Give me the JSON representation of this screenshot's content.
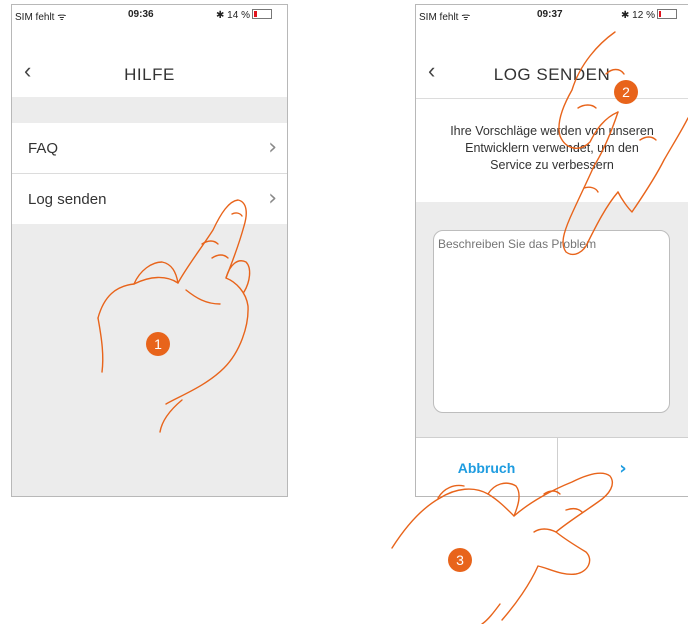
{
  "screen1": {
    "status": {
      "carrier": "SIM fehlt",
      "time": "09:36",
      "battery": "14 %"
    },
    "nav": {
      "back_icon": "‹",
      "title": "HILFE"
    },
    "menu": [
      {
        "label": "FAQ",
        "chevron": "›"
      },
      {
        "label": "Log senden",
        "chevron": "›"
      }
    ]
  },
  "screen2": {
    "status": {
      "carrier": "SIM fehlt",
      "time": "09:37",
      "battery": "12 %"
    },
    "nav": {
      "back_icon": "‹",
      "title": "LOG SENDEN"
    },
    "message_lines": [
      "Ihre Vorschläge werden von unseren",
      "Entwicklern verwendet, um den",
      "Service zu verbessern"
    ],
    "textarea_placeholder": "Beschreiben Sie das Problem",
    "buttons": {
      "cancel": "Abbruch",
      "next": "›"
    }
  },
  "steps": [
    "1",
    "2",
    "3"
  ],
  "colors": {
    "accent_blue": "#1e9ce0",
    "step_orange": "#e8641b",
    "hand_outline": "#e8641b",
    "battery_red": "#e0141e"
  }
}
